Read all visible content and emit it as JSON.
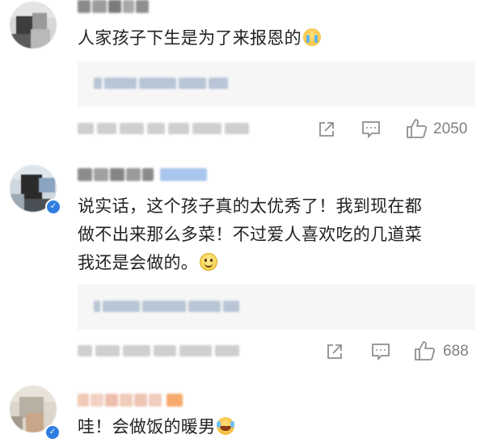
{
  "comments": [
    {
      "text": "人家孩子下生是为了来报恩的",
      "emoji": "crying-face",
      "likes": "2050"
    },
    {
      "text_lines": [
        "说实话，这个孩子真的太优秀了！我到现在都",
        "做不出来那么多菜！不过爱人喜欢吃的几道菜",
        "我还是会做的。"
      ],
      "emoji": "smiling-face",
      "likes": "688"
    },
    {
      "text": "哇！会做饭的暖男",
      "emoji": "laughing-tears-face"
    }
  ],
  "icons": {
    "share": "share-icon",
    "comment": "comment-icon",
    "like": "thumbs-up-icon"
  },
  "colors": {
    "text": "#222222",
    "meta": "#8e8e8e",
    "reply_bg": "#f6f6f6",
    "verified": "#2f7de1"
  }
}
